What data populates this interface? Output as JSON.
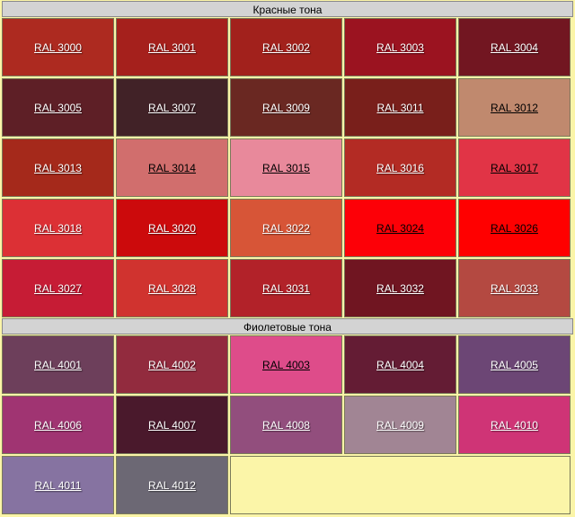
{
  "sections": [
    {
      "title": "Красные тона",
      "swatches": [
        {
          "label": "RAL 3000",
          "color": "#ad2a20",
          "light": false
        },
        {
          "label": "RAL 3001",
          "color": "#a5201c",
          "light": false
        },
        {
          "label": "RAL 3002",
          "color": "#a2211c",
          "light": false
        },
        {
          "label": "RAL 3003",
          "color": "#9b1320",
          "light": false
        },
        {
          "label": "RAL 3004",
          "color": "#721621",
          "light": false
        },
        {
          "label": "RAL 3005",
          "color": "#5e1f26",
          "light": false
        },
        {
          "label": "RAL 3007",
          "color": "#412227",
          "light": false
        },
        {
          "label": "RAL 3009",
          "color": "#6a2822",
          "light": false
        },
        {
          "label": "RAL 3011",
          "color": "#791f1b",
          "light": false
        },
        {
          "label": "RAL 3012",
          "color": "#c0896e",
          "light": true
        },
        {
          "label": "RAL 3013",
          "color": "#a5291b",
          "light": false
        },
        {
          "label": "RAL 3014",
          "color": "#d16e6d",
          "light": true
        },
        {
          "label": "RAL 3015",
          "color": "#e8899b",
          "light": true
        },
        {
          "label": "RAL 3016",
          "color": "#b32b24",
          "light": false
        },
        {
          "label": "RAL 3017",
          "color": "#e13446",
          "light": true
        },
        {
          "label": "RAL 3018",
          "color": "#dc3035",
          "light": false
        },
        {
          "label": "RAL 3020",
          "color": "#cc0a0c",
          "light": false
        },
        {
          "label": "RAL 3022",
          "color": "#d75537",
          "light": false
        },
        {
          "label": "RAL 3024",
          "color": "#fd0007",
          "light": true
        },
        {
          "label": "RAL 3026",
          "color": "#ff0000",
          "light": true
        },
        {
          "label": "RAL 3027",
          "color": "#c61c35",
          "light": false
        },
        {
          "label": "RAL 3028",
          "color": "#d0332f",
          "light": false
        },
        {
          "label": "RAL 3031",
          "color": "#b22229",
          "light": false
        },
        {
          "label": "RAL 3032",
          "color": "#701521",
          "light": false
        },
        {
          "label": "RAL 3033",
          "color": "#b44941",
          "light": false
        }
      ]
    },
    {
      "title": "Фиолетовые тона",
      "swatches": [
        {
          "label": "RAL 4001",
          "color": "#6d3f5b",
          "light": false
        },
        {
          "label": "RAL 4002",
          "color": "#922b3e",
          "light": false
        },
        {
          "label": "RAL 4003",
          "color": "#de4c8a",
          "light": true
        },
        {
          "label": "RAL 4004",
          "color": "#641c34",
          "light": false
        },
        {
          "label": "RAL 4005",
          "color": "#6c4675",
          "light": false
        },
        {
          "label": "RAL 4006",
          "color": "#a03472",
          "light": false
        },
        {
          "label": "RAL 4007",
          "color": "#4a192c",
          "light": false
        },
        {
          "label": "RAL 4008",
          "color": "#924e7d",
          "light": false
        },
        {
          "label": "RAL 4009",
          "color": "#a18594",
          "light": false
        },
        {
          "label": "RAL 4010",
          "color": "#cf3476",
          "light": false
        },
        {
          "label": "RAL 4011",
          "color": "#8673a1",
          "light": false
        },
        {
          "label": "RAL 4012",
          "color": "#6c6874",
          "light": false
        }
      ]
    }
  ]
}
